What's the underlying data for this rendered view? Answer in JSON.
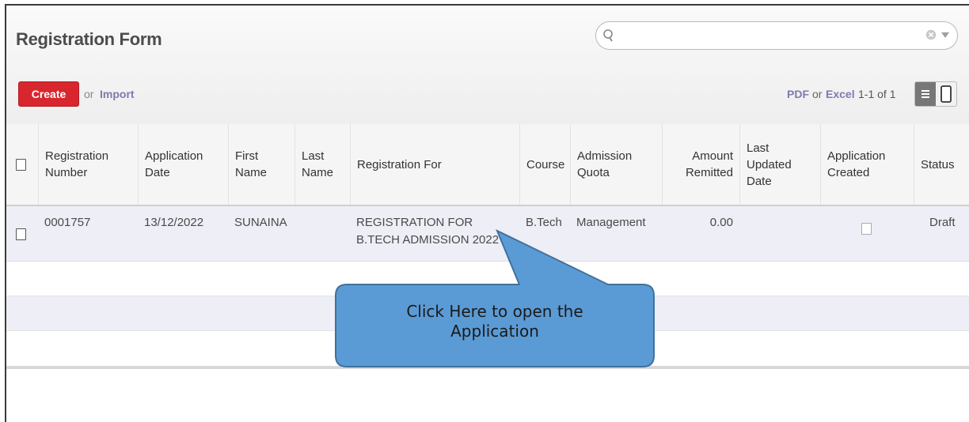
{
  "page": {
    "title": "Registration Form"
  },
  "search": {
    "placeholder": ""
  },
  "toolbar": {
    "create_label": "Create",
    "or_label": "or",
    "import_label": "Import",
    "pdf_label": "PDF",
    "or2_label": "or",
    "excel_label": "Excel",
    "pager": "1-1 of 1"
  },
  "table": {
    "columns": [
      {
        "line1": "Registration",
        "line2": "Number"
      },
      {
        "line1": "Application",
        "line2": "Date"
      },
      {
        "line1": "First",
        "line2": "Name"
      },
      {
        "line1": "Last",
        "line2": "Name"
      },
      {
        "line1": "Registration For",
        "line2": ""
      },
      {
        "line1": "Course",
        "line2": ""
      },
      {
        "line1": "Admission",
        "line2": "Quota"
      },
      {
        "line1": "Amount",
        "line2": "Remitted"
      },
      {
        "line1": "Last",
        "line2": "Updated",
        "line3": "Date"
      },
      {
        "line1": "Application",
        "line2": "Created"
      },
      {
        "line1": "Status",
        "line2": ""
      }
    ],
    "rows": [
      {
        "registration_number": "0001757",
        "application_date": "13/12/2022",
        "first_name": "SUNAINA",
        "last_name": "",
        "registration_for_line1": "REGISTRATION FOR",
        "registration_for_line2": "B.TECH ADMISSION 2022",
        "course": "B.Tech",
        "admission_quota": "Management",
        "amount_remitted": "0.00",
        "last_updated_date": "",
        "application_created": false,
        "status": "Draft"
      }
    ]
  },
  "callout": {
    "line1": "Click Here to open the",
    "line2": "Application"
  },
  "colors": {
    "create_button": "#d9262e",
    "link": "#7c7bad",
    "callout_fill": "#5b9bd5",
    "callout_border": "#41719c",
    "row_stripe": "#eeeef6"
  },
  "icons": {
    "search": "magnifier-icon",
    "clear": "clear-circle-icon",
    "dropdown": "caret-down-icon",
    "list_view": "list-view-icon",
    "form_view": "form-view-icon"
  }
}
